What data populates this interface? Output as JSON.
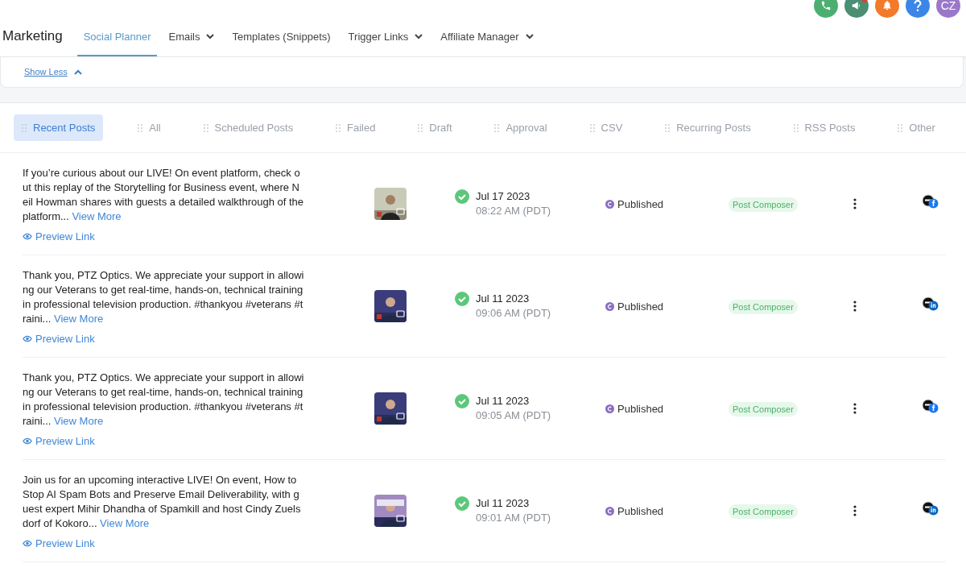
{
  "top_bar": {
    "avatar": "CZ",
    "notification_dot": true
  },
  "header": {
    "title": "Marketing",
    "nav": [
      {
        "label": "Social Planner",
        "selected": true,
        "dropdown": false
      },
      {
        "label": "Emails",
        "selected": false,
        "dropdown": true
      },
      {
        "label": "Templates (Snippets)",
        "selected": false,
        "dropdown": false
      },
      {
        "label": "Trigger Links",
        "selected": false,
        "dropdown": true
      },
      {
        "label": "Affiliate Manager",
        "selected": false,
        "dropdown": true
      }
    ]
  },
  "toggle_link": "Show Less",
  "filters": [
    {
      "label": "Recent Posts",
      "selected": true
    },
    {
      "label": "All",
      "selected": false
    },
    {
      "label": "Scheduled Posts",
      "selected": false
    },
    {
      "label": "Failed",
      "selected": false
    },
    {
      "label": "Draft",
      "selected": false
    },
    {
      "label": "Approval",
      "selected": false
    },
    {
      "label": "CSV",
      "selected": false
    },
    {
      "label": "Recurring Posts",
      "selected": false
    },
    {
      "label": "RSS Posts",
      "selected": false
    },
    {
      "label": "Other",
      "selected": false
    }
  ],
  "posts": [
    {
      "text": "If you’re curious about our LIVE! On event platform, check out this replay of the Storytelling for Business event, where Neil Howman shares with guests a detailed walkthrough of the platform...",
      "more": "View More",
      "preview": "Preview Link",
      "date": "Jul 17 2023",
      "time": "08:22 AM (PDT)",
      "status": "Published",
      "source": "Post Composer",
      "kind": "facebook"
    },
    {
      "text": "Thank you, PTZ Optics. We appreciate your support in allowing our Veterans to get real-time, hands-on, technical training in professional television production. #thankyou #veterans #traini...",
      "more": "View More",
      "preview": "Preview Link",
      "date": "Jul 11 2023",
      "time": "09:06 AM (PDT)",
      "status": "Published",
      "source": "Post Composer",
      "kind": "linkedin"
    },
    {
      "text": "Thank you, PTZ Optics. We appreciate your support in allowing our Veterans to get real-time, hands-on, technical training in professional television production. #thankyou #veterans #traini...",
      "more": "View More",
      "preview": "Preview Link",
      "date": "Jul 11 2023",
      "time": "09:05 AM (PDT)",
      "status": "Published",
      "source": "Post Composer",
      "kind": "facebook"
    },
    {
      "text": "Join us for an upcoming interactive LIVE! On event, How to Stop AI Spam Bots and Preserve Email Deliverability, with guest expert Mihir Dhandha of Spamkill and host Cindy Zuelsdorf of Kokoro...",
      "more": "View More",
      "preview": "Preview Link",
      "date": "Jul 11 2023",
      "time": "09:01 AM (PDT)",
      "status": "Published",
      "source": "Post Composer",
      "kind": "linkedin"
    }
  ]
}
